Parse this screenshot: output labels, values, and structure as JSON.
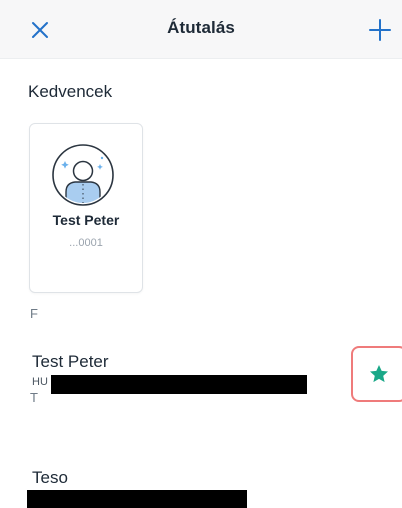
{
  "header": {
    "title": "Átutalás",
    "close_icon": "close-icon",
    "add_icon": "plus-icon",
    "accent_color": "#2372c9"
  },
  "favorites": {
    "title": "Kedvencek",
    "items": [
      {
        "name": "Test Peter",
        "account": "...0001",
        "icon": "user-avatar-icon"
      }
    ]
  },
  "contacts": {
    "groups": [
      {
        "letter": "F",
        "items": [
          {
            "name": "Test Peter",
            "account_prefix": "HU",
            "favorite": true,
            "favorite_icon": "star-icon",
            "favorite_color": "#1aa888"
          }
        ]
      },
      {
        "letter": "T",
        "items": [
          {
            "name": "Teso"
          }
        ]
      }
    ]
  }
}
